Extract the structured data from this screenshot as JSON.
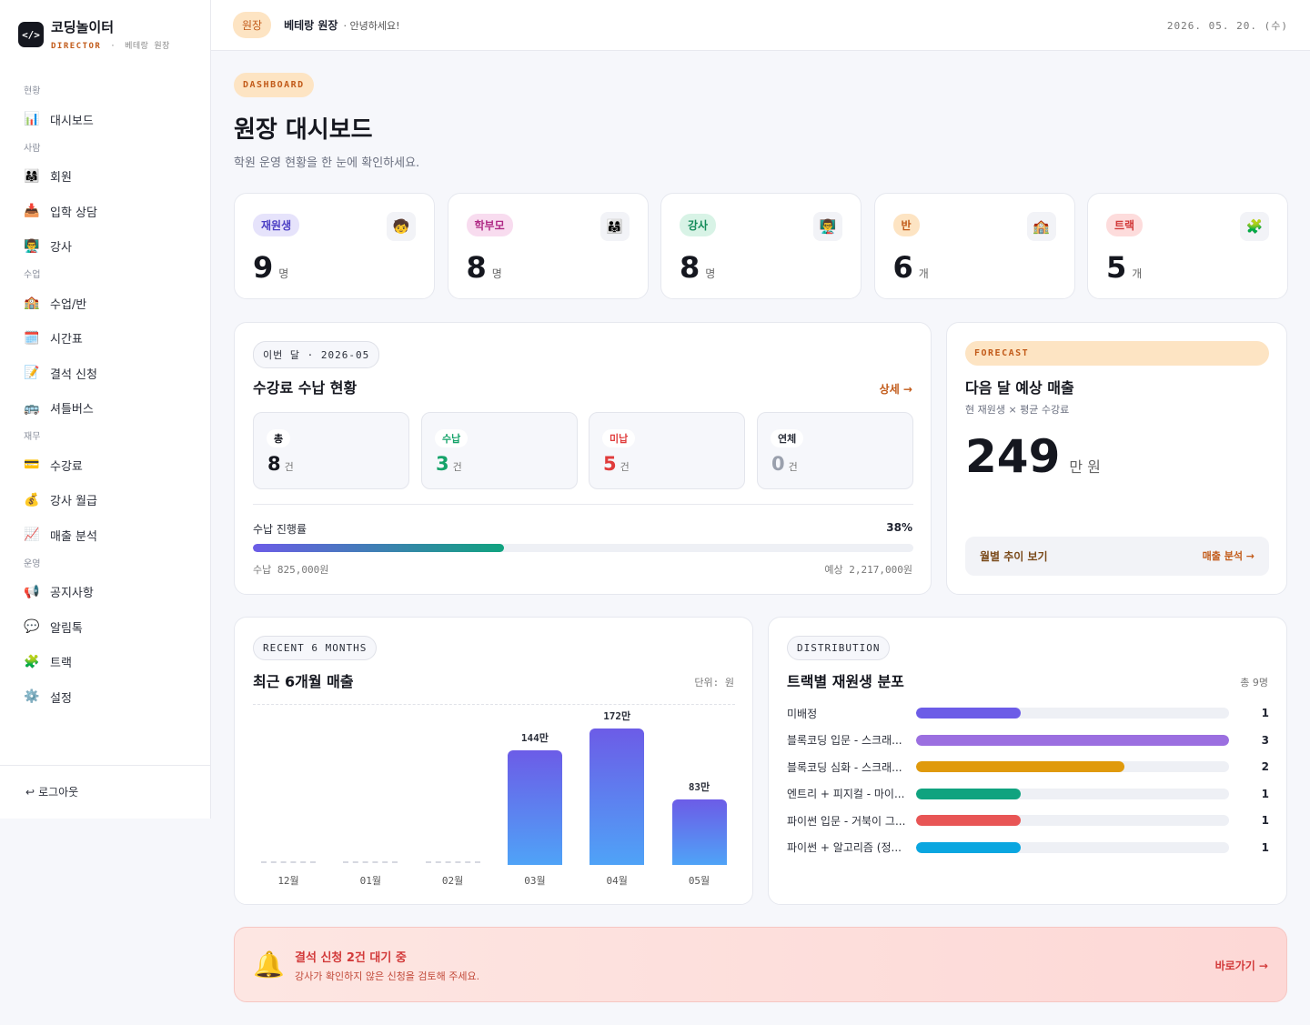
{
  "brand": {
    "logo": "</>",
    "name": "코딩놀이터",
    "role": "DIRECTOR",
    "sep": "·",
    "user": "베테랑 원장"
  },
  "nav": [
    {
      "section": "현황",
      "items": [
        {
          "icon": "📊",
          "label": "대시보드",
          "name": "dashboard"
        }
      ]
    },
    {
      "section": "사람",
      "items": [
        {
          "icon": "👨‍👩‍👧",
          "label": "회원",
          "name": "members"
        },
        {
          "icon": "📥",
          "label": "입학 상담",
          "name": "admission"
        },
        {
          "icon": "👨‍🏫",
          "label": "강사",
          "name": "teachers"
        }
      ]
    },
    {
      "section": "수업",
      "items": [
        {
          "icon": "🏫",
          "label": "수업/반",
          "name": "classes"
        },
        {
          "icon": "🗓️",
          "label": "시간표",
          "name": "timetable"
        },
        {
          "icon": "📝",
          "label": "결석 신청",
          "name": "absence"
        },
        {
          "icon": "🚌",
          "label": "셔틀버스",
          "name": "shuttle"
        }
      ]
    },
    {
      "section": "재무",
      "items": [
        {
          "icon": "💳",
          "label": "수강료",
          "name": "tuition"
        },
        {
          "icon": "💰",
          "label": "강사 월급",
          "name": "payroll"
        },
        {
          "icon": "📈",
          "label": "매출 분석",
          "name": "revenue"
        }
      ]
    },
    {
      "section": "운영",
      "items": [
        {
          "icon": "📢",
          "label": "공지사항",
          "name": "notice"
        },
        {
          "icon": "💬",
          "label": "알림톡",
          "name": "alimtalk"
        },
        {
          "icon": "🧩",
          "label": "트랙",
          "name": "tracks"
        },
        {
          "icon": "⚙️",
          "label": "설정",
          "name": "settings"
        }
      ]
    }
  ],
  "logout": {
    "icon": "↩",
    "label": "로그아웃"
  },
  "topbar": {
    "role": "원장",
    "name": "베테랑 원장",
    "greet": "· 안녕하세요!",
    "date": "2026. 05. 20. (수)"
  },
  "header": {
    "badge": "DASHBOARD",
    "title": "원장 대시보드",
    "subtitle": "학원 운영 현황을 한 눈에 확인하세요."
  },
  "kpis": [
    {
      "label": "재원생",
      "icon": "🧒",
      "value": "9",
      "unit": "명",
      "bg": "#e6e3fb",
      "fg": "#4b3fc4"
    },
    {
      "label": "학부모",
      "icon": "👨‍👩‍👧",
      "value": "8",
      "unit": "명",
      "bg": "#f8dcef",
      "fg": "#b02a86"
    },
    {
      "label": "강사",
      "icon": "👨‍🏫",
      "value": "8",
      "unit": "명",
      "bg": "#d8f3e6",
      "fg": "#128a58"
    },
    {
      "label": "반",
      "icon": "🏫",
      "value": "6",
      "unit": "개",
      "bg": "#fde4c3",
      "fg": "#c25b1a"
    },
    {
      "label": "트랙",
      "icon": "🧩",
      "value": "5",
      "unit": "개",
      "bg": "#fddcdc",
      "fg": "#d23a3a"
    }
  ],
  "tuition": {
    "tag": "이번 달 · 2026-05",
    "title": "수강료 수납 현황",
    "detail": "상세 →",
    "stats": [
      {
        "label": "총",
        "value": "8",
        "unit": "건",
        "fg": "#15171f",
        "pill_fg": "#15171f"
      },
      {
        "label": "수납",
        "value": "3",
        "unit": "건",
        "fg": "#16a36a",
        "pill_fg": "#16a36a"
      },
      {
        "label": "미납",
        "value": "5",
        "unit": "건",
        "fg": "#e03c3c",
        "pill_fg": "#e03c3c"
      },
      {
        "label": "연체",
        "value": "0",
        "unit": "건",
        "fg": "#9aa0ad",
        "pill_fg": "#2b2f3a"
      }
    ],
    "progress_label": "수납 진행률",
    "progress_pct_text": "38%",
    "progress_pct": 38,
    "collected": "수납 825,000원",
    "expected": "예상 2,217,000원"
  },
  "forecast": {
    "badge": "FORECAST",
    "title": "다음 달 예상 매출",
    "subtitle": "현 재원생 × 평균 수강료",
    "value": "249",
    "unit": "만 원",
    "link_label": "월별 추이 보기",
    "link_action": "매출 분석 →"
  },
  "revenue": {
    "tag": "RECENT 6 MONTHS",
    "title": "최근 6개월 매출",
    "unit_note": "단위: 원"
  },
  "chart_data": {
    "type": "bar",
    "categories": [
      "12월",
      "01월",
      "02월",
      "03월",
      "04월",
      "05월"
    ],
    "values": [
      0,
      0,
      0,
      144,
      172,
      83
    ],
    "labels": [
      "",
      "",
      "",
      "144만",
      "172만",
      "83만"
    ],
    "ylabel": "",
    "unit": "만 원"
  },
  "distribution": {
    "tag": "DISTRIBUTION",
    "title": "트랙별 재원생 분포",
    "total": "총 9명",
    "max": 3,
    "rows": [
      {
        "label": "미배정",
        "value": 1,
        "color": "#6c5ce7"
      },
      {
        "label": "블록코딩 입문 - 스크래...",
        "value": 3,
        "color": "#9b6fe0"
      },
      {
        "label": "블록코딩 심화 - 스크래...",
        "value": 2,
        "color": "#e09a0c"
      },
      {
        "label": "엔트리 + 피지컬 - 마이...",
        "value": 1,
        "color": "#10a37f"
      },
      {
        "label": "파이썬 입문 - 거북이 그...",
        "value": 1,
        "color": "#e85555"
      },
      {
        "label": "파이썬 + 알고리즘 (정...",
        "value": 1,
        "color": "#0aa6e0"
      }
    ]
  },
  "alert": {
    "icon": "🔔",
    "title": "결석 신청 2건 대기 중",
    "subtitle": "강사가 확인하지 않은 신청을 검토해 주세요.",
    "action": "바로가기 →"
  }
}
